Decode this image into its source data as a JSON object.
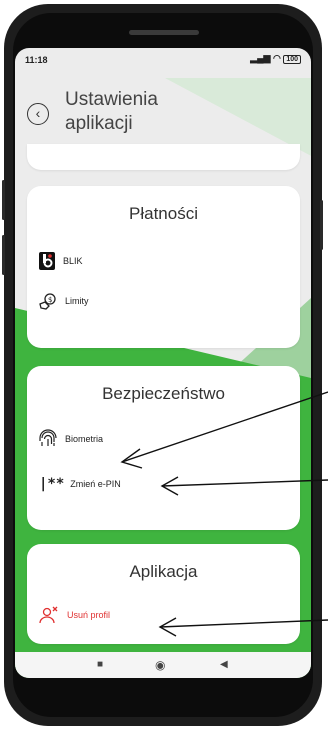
{
  "status": {
    "time": "11:18",
    "battery": "100"
  },
  "header": {
    "title_line1": "Ustawienia",
    "title_line2": "aplikacji"
  },
  "payments": {
    "title": "Płatności",
    "items": [
      {
        "label": "BLIK"
      },
      {
        "label": "Limity"
      }
    ]
  },
  "security": {
    "title": "Bezpieczeństwo",
    "items": [
      {
        "label": "Biometria"
      },
      {
        "label": "Zmień e-PIN",
        "icon_text": "|**"
      }
    ]
  },
  "application": {
    "title": "Aplikacja",
    "items": [
      {
        "label": "Usuń profil"
      }
    ]
  },
  "colors": {
    "accent_green": "#3fb43f",
    "danger_red": "#e03030"
  }
}
